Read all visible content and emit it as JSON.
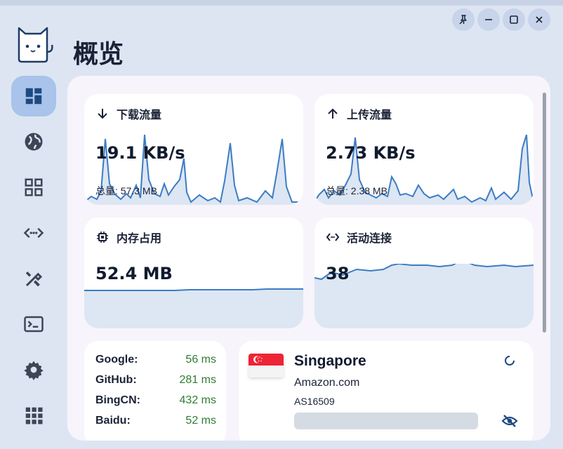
{
  "app": {
    "page_title": "概览",
    "window_controls": [
      "pin-icon",
      "minimize-icon",
      "maximize-icon",
      "close-icon"
    ]
  },
  "sidebar": {
    "items": [
      {
        "icon": "dashboard-icon",
        "active": true
      },
      {
        "icon": "globe-icon",
        "active": false
      },
      {
        "icon": "grid-icon",
        "active": false
      },
      {
        "icon": "code-arrows-icon",
        "active": false
      },
      {
        "icon": "tools-icon",
        "active": false
      },
      {
        "icon": "terminal-icon",
        "active": false
      },
      {
        "icon": "gear-icon",
        "active": false
      },
      {
        "icon": "apps-icon",
        "active": false
      }
    ]
  },
  "cards": {
    "download": {
      "title": "下载流量",
      "value": "19.1 KB/s",
      "total": "总量: 57.3 MB"
    },
    "upload": {
      "title": "上传流量",
      "value": "2.73 KB/s",
      "total": "总量: 2.38 MB"
    },
    "memory": {
      "title": "内存占用",
      "value": "52.4 MB"
    },
    "connections": {
      "title": "活动连接",
      "value": "38"
    }
  },
  "latency": [
    {
      "name": "Google:",
      "ms": "56 ms"
    },
    {
      "name": "GitHub:",
      "ms": "281 ms"
    },
    {
      "name": "BingCN:",
      "ms": "432 ms"
    },
    {
      "name": "Baidu:",
      "ms": "52 ms"
    }
  ],
  "ip_info": {
    "country": "Singapore",
    "org": "Amazon.com",
    "asn": "AS16509"
  },
  "colors": {
    "accent": "#3b7cc4",
    "latency_good": "#2e7d32",
    "active_nav": "#a9c3ea"
  }
}
